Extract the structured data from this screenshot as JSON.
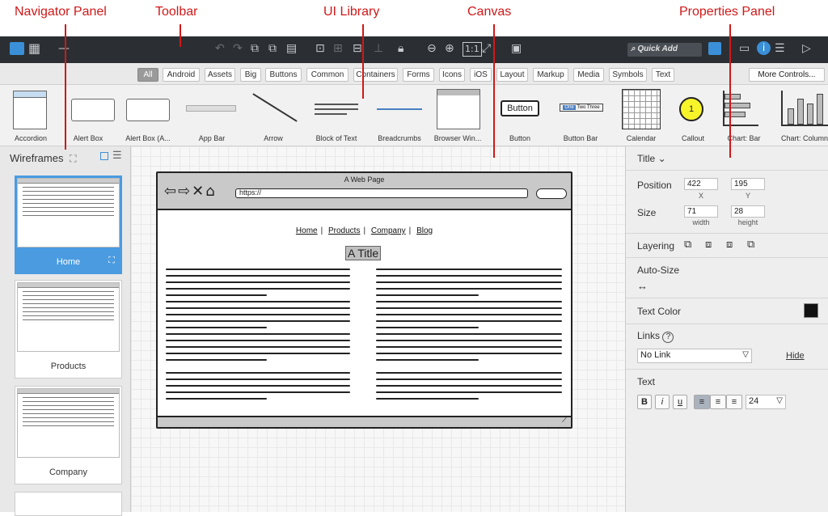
{
  "annotations": {
    "navigator": "Navigator Panel",
    "toolbar": "Toolbar",
    "library": "UI Library",
    "canvas": "Canvas",
    "properties": "Properties Panel"
  },
  "toolbar": {
    "quick_add": "Quick Add"
  },
  "tabs": [
    "All",
    "Android",
    "Assets",
    "Big",
    "Buttons",
    "Common",
    "Containers",
    "Forms",
    "Icons",
    "iOS",
    "Layout",
    "Markup",
    "Media",
    "Symbols",
    "Text"
  ],
  "more_controls": "More Controls...",
  "library": {
    "items": [
      "Accordion",
      "Alert Box",
      "Alert Box (A...",
      "App Bar",
      "Arrow",
      "Block of Text",
      "Breadcrumbs",
      "Browser Win...",
      "Button",
      "Button Bar",
      "Calendar",
      "Callout",
      "Chart: Bar",
      "Chart: Column"
    ],
    "button_text": "Button",
    "button_bar": [
      "One",
      "Two",
      "Three"
    ],
    "callout_number": "1"
  },
  "navigator": {
    "title": "Wireframes",
    "pages": [
      "Home",
      "Products",
      "Company"
    ]
  },
  "canvas": {
    "page_title": "A Web Page",
    "url": "https://",
    "links": [
      "Home",
      "Products",
      "Company",
      "Blog"
    ],
    "heading": "A Title"
  },
  "properties": {
    "title": "Title",
    "position_label": "Position",
    "x": "422",
    "y": "195",
    "x_label": "X",
    "y_label": "Y",
    "size_label": "Size",
    "width": "71",
    "height": "28",
    "width_label": "width",
    "height_label": "height",
    "layering_label": "Layering",
    "autosize_label": "Auto-Size",
    "text_color_label": "Text Color",
    "text_color": "#111111",
    "links_label": "Links",
    "link_value": "No Link",
    "hide_label": "Hide",
    "text_label": "Text",
    "bold": "B",
    "italic": "i",
    "underline": "u",
    "font_size": "24"
  }
}
